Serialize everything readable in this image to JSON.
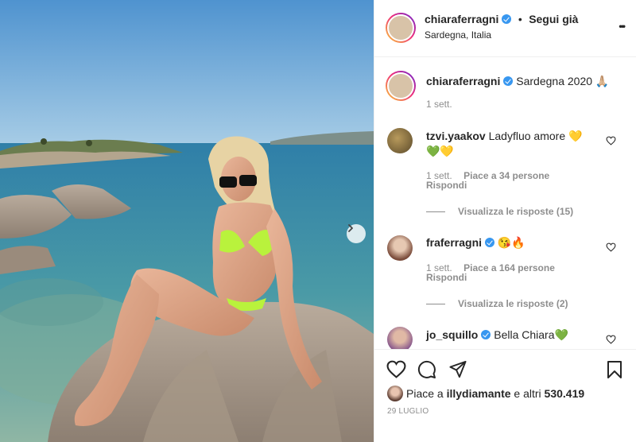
{
  "post": {
    "username": "chiaraferragni",
    "separator": "•",
    "follow_label": "Segui già",
    "location": "Sardegna, Italia",
    "more_label": "•••"
  },
  "caption": {
    "username": "chiaraferragni",
    "text": "Sardegna 2020 🙏🏼",
    "time": "1 sett."
  },
  "comments": [
    {
      "username": "tzvi.yaakov",
      "text": "Ladyfluo amore 💛",
      "text2": "💚💛",
      "time": "1 sett.",
      "likes": "Piace a 34 persone",
      "reply": "Rispondi",
      "view_replies": "Visualizza le risposte (15)"
    },
    {
      "username": "fraferragni",
      "text": "😘🔥",
      "time": "1 sett.",
      "likes": "Piace a 164 persone",
      "reply": "Rispondi",
      "view_replies": "Visualizza le risposte (2)"
    },
    {
      "username": "jo_squillo",
      "text": "Bella Chiara💚"
    }
  ],
  "likes": {
    "prefix": "Piace a",
    "user": "illydiamante",
    "suffix": "e altri",
    "count": "530.419"
  },
  "date": "29 LUGLIO",
  "colors": {
    "link": "#00376b",
    "verified": "#3897f0",
    "muted": "#8e8e8e"
  }
}
